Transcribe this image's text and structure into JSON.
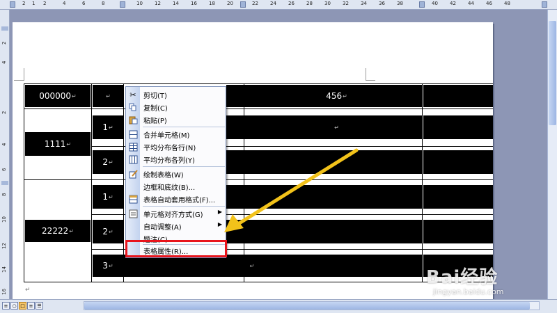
{
  "ruler": {
    "top_labels": [
      "2",
      "1",
      "2",
      "4",
      "6",
      "8",
      "10",
      "12",
      "14",
      "16",
      "18",
      "20",
      "22",
      "24",
      "26",
      "28",
      "30",
      "32",
      "34",
      "36",
      "38",
      "40",
      "42",
      "44",
      "46",
      "48"
    ],
    "left_labels": [
      "4",
      "2",
      "2",
      "4",
      "6",
      "8",
      "10",
      "12",
      "14",
      "16"
    ]
  },
  "table": {
    "row_labels": [
      "000000",
      "1111",
      "22222"
    ],
    "sub_labels": [
      "1",
      "2",
      "1",
      "2",
      "3"
    ],
    "cell_456": "456",
    "para_mark": "↵"
  },
  "context_menu": {
    "items": [
      {
        "label": "剪切(T)",
        "icon": "scissors-icon"
      },
      {
        "label": "复制(C)",
        "icon": "copy-icon"
      },
      {
        "label": "粘贴(P)",
        "icon": "paste-icon"
      },
      {
        "label": "合并单元格(M)",
        "icon": "merge-cells-icon"
      },
      {
        "label": "平均分布各行(N)",
        "icon": "distribute-rows-icon"
      },
      {
        "label": "平均分布各列(Y)",
        "icon": "distribute-columns-icon"
      },
      {
        "label": "绘制表格(W)",
        "icon": "draw-table-icon"
      },
      {
        "label": "边框和底纹(B)...",
        "icon": ""
      },
      {
        "label": "表格自动套用格式(F)...",
        "icon": "autoformat-icon"
      },
      {
        "label": "单元格对齐方式(G)",
        "icon": "cell-align-icon"
      },
      {
        "label": "自动调整(A)",
        "icon": ""
      },
      {
        "label": "题注(C)...",
        "icon": ""
      },
      {
        "label": "表格属性(R)...",
        "icon": ""
      }
    ]
  },
  "watermark": {
    "brand": "Bai经验",
    "url": "jingyan.baidu.com"
  },
  "colors": {
    "highlight": "#e8141c",
    "arrow": "#f2c21a"
  }
}
